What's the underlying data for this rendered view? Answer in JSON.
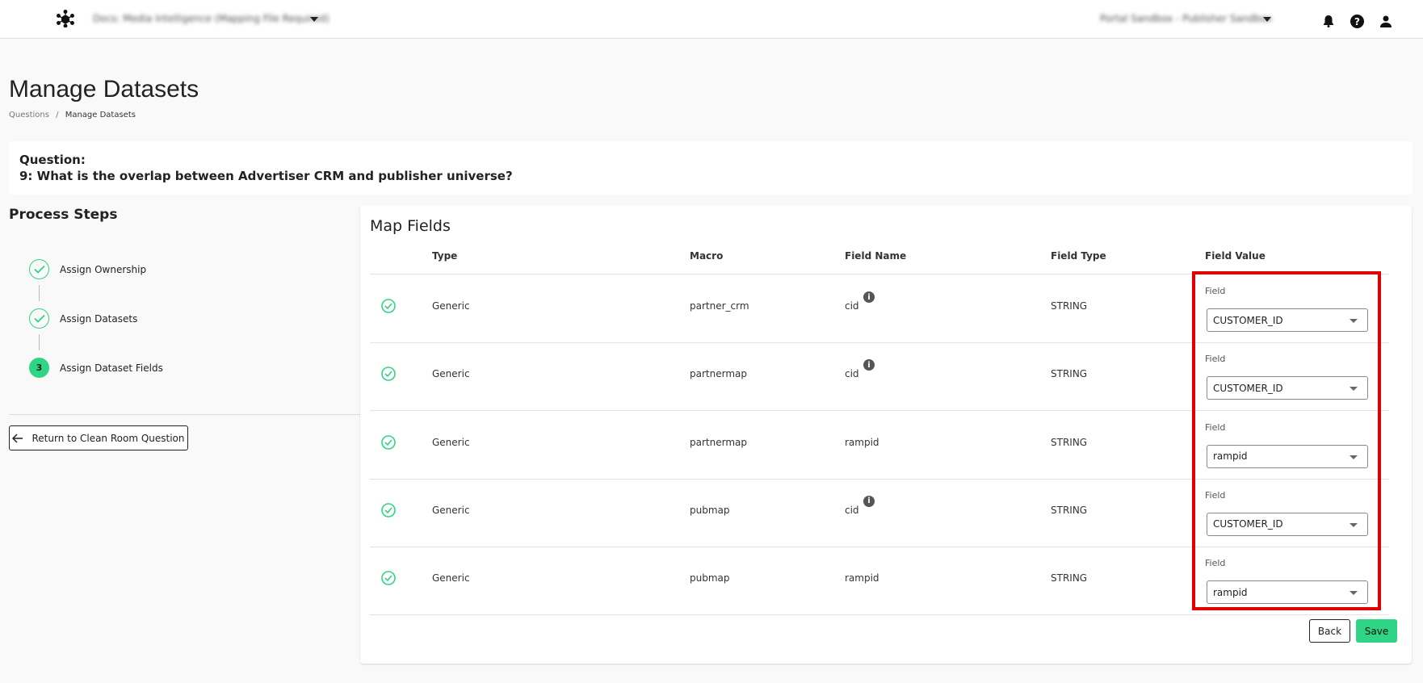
{
  "header": {
    "title": "Docs: Media Intelligence (Mapping File Required)",
    "org": "Portal Sandbox - Publisher Sandbox",
    "icons": [
      "logo-icon",
      "bell-icon",
      "help-icon",
      "user-icon"
    ]
  },
  "page": {
    "title": "Manage Datasets",
    "breadcrumb": [
      "Questions",
      "Manage Datasets"
    ],
    "breadcrumb_sep": "/"
  },
  "question": {
    "label": "Question:",
    "text": "9: What is the overlap between Advertiser CRM and publisher universe?"
  },
  "process": {
    "title": "Process Steps",
    "steps": [
      {
        "label": "Assign Ownership",
        "status": "done"
      },
      {
        "label": "Assign Datasets",
        "status": "done"
      },
      {
        "label": "Assign Dataset Fields",
        "status": "active",
        "number": "3"
      }
    ],
    "return_label": "Return to Clean Room Question"
  },
  "map": {
    "title": "Map Fields",
    "columns": [
      "Type",
      "Macro",
      "Field Name",
      "Field Type",
      "Field Value"
    ],
    "rows": [
      {
        "type": "Generic",
        "macro": "partner_crm",
        "field_name": "cid",
        "info": true,
        "field_type": "STRING",
        "value_label": "Field",
        "value": "CUSTOMER_ID"
      },
      {
        "type": "Generic",
        "macro": "partnermap",
        "field_name": "cid",
        "info": true,
        "field_type": "STRING",
        "value_label": "Field",
        "value": "CUSTOMER_ID"
      },
      {
        "type": "Generic",
        "macro": "partnermap",
        "field_name": "rampid",
        "info": false,
        "field_type": "STRING",
        "value_label": "Field",
        "value": "rampid"
      },
      {
        "type": "Generic",
        "macro": "pubmap",
        "field_name": "cid",
        "info": true,
        "field_type": "STRING",
        "value_label": "Field",
        "value": "CUSTOMER_ID"
      },
      {
        "type": "Generic",
        "macro": "pubmap",
        "field_name": "rampid",
        "info": false,
        "field_type": "STRING",
        "value_label": "Field",
        "value": "rampid"
      }
    ],
    "back_label": "Back",
    "save_label": "Save"
  },
  "colors": {
    "accent": "#2fd485",
    "highlight": "#e00000"
  }
}
